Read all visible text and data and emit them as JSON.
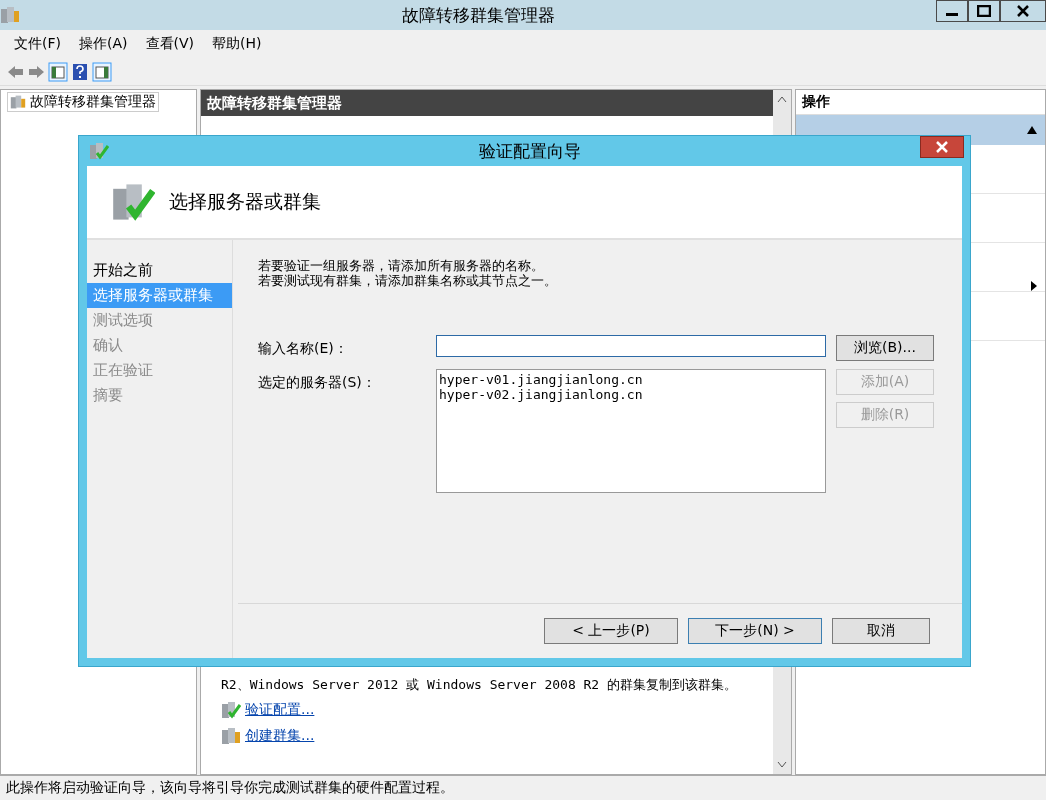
{
  "window": {
    "title": "故障转移群集管理器"
  },
  "menu": [
    "文件(F)",
    "操作(A)",
    "查看(V)",
    "帮助(H)"
  ],
  "tree": [
    {
      "label": "故障转移群集管理器"
    }
  ],
  "center_panel": {
    "header": "故障转移群集管理器",
    "lines": [
      "R2、Windows Server 2012 或 Windows Server 2008 R2 的群集复制到该群集。"
    ],
    "links": [
      {
        "label": "验证配置...",
        "kind": "validate"
      },
      {
        "label": "创建群集...",
        "kind": "create"
      }
    ]
  },
  "actions_panel": {
    "header": "操作"
  },
  "status_bar": "此操作将启动验证向导，该向导将引导你完成测试群集的硬件配置过程。",
  "dialog": {
    "title": "验证配置向导",
    "heading": "选择服务器或群集",
    "steps": [
      {
        "label": "开始之前",
        "selected": false,
        "disabled": false
      },
      {
        "label": "选择服务器或群集",
        "selected": true,
        "disabled": false
      },
      {
        "label": "测试选项",
        "selected": false,
        "disabled": true
      },
      {
        "label": "确认",
        "selected": false,
        "disabled": true
      },
      {
        "label": "正在验证",
        "selected": false,
        "disabled": true
      },
      {
        "label": "摘要",
        "selected": false,
        "disabled": true
      }
    ],
    "intro": [
      "若要验证一组服务器，请添加所有服务器的名称。",
      "若要测试现有群集，请添加群集名称或其节点之一。"
    ],
    "name_field": {
      "label": "输入名称(E)："
    },
    "servers_label": "选定的服务器(S)：",
    "servers": [
      "hyper-v01.jiangjianlong.cn",
      "hyper-v02.jiangjianlong.cn"
    ],
    "side_buttons": [
      {
        "label": "浏览(B)...",
        "disabled": false
      },
      {
        "label": "添加(A)",
        "disabled": true
      },
      {
        "label": "删除(R)",
        "disabled": true
      }
    ],
    "buttons": [
      {
        "label": "< 上一步(P)",
        "default": false
      },
      {
        "label": "下一步(N) >",
        "default": true
      },
      {
        "label": "取消",
        "default": false
      }
    ]
  }
}
